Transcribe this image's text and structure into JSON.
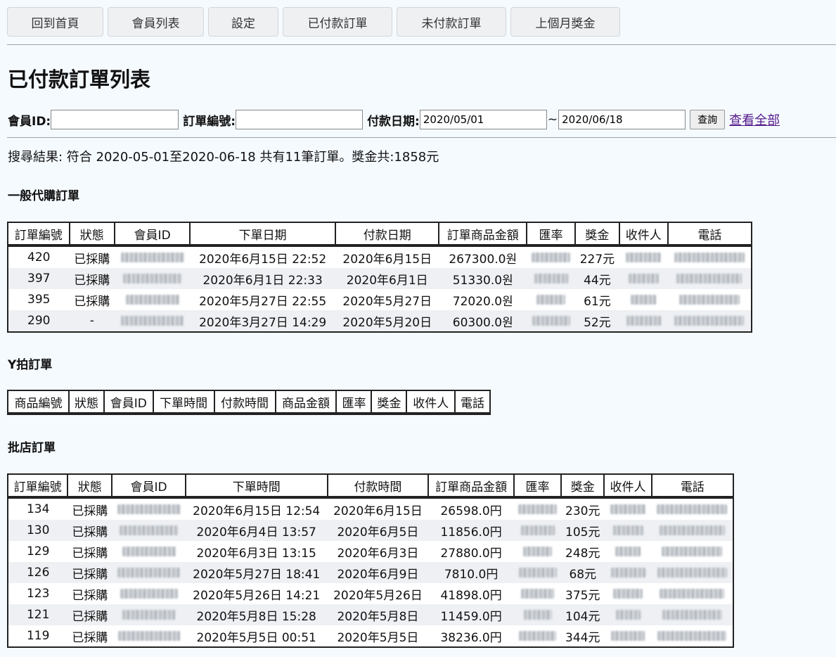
{
  "nav": {
    "items": [
      "回到首頁",
      "會員列表",
      "設定",
      "已付款訂單",
      "未付款訂單",
      "上個月獎金"
    ]
  },
  "page_title": "已付款訂單列表",
  "search": {
    "member_id_label": "會員ID:",
    "member_id_value": "",
    "order_no_label": "訂單編號:",
    "order_no_value": "",
    "pay_date_label": "付款日期:",
    "date_from": "2020/05/01",
    "tilde": "~",
    "date_to": "2020/06/18",
    "query_label": "查詢",
    "view_all_label": "查看全部"
  },
  "summary": "搜尋結果: 符合 2020-05-01至2020-06-18 共有11筆訂單。獎金共:1858元",
  "general": {
    "title": "一般代購訂單",
    "headers": [
      "訂單編號",
      "狀態",
      "會員ID",
      "下單日期",
      "付款日期",
      "訂單商品金額",
      "匯率",
      "獎金",
      "收件人",
      "電話"
    ],
    "rows": [
      {
        "id": "420",
        "status": "已採購",
        "order_date": "2020年6月15日 22:52",
        "pay_date": "2020年6月15日",
        "amount": "267300.0원",
        "bonus": "227元"
      },
      {
        "id": "397",
        "status": "已採購",
        "order_date": "2020年6月1日 22:33",
        "pay_date": "2020年6月1日",
        "amount": "51330.0원",
        "bonus": "44元"
      },
      {
        "id": "395",
        "status": "已採購",
        "order_date": "2020年5月27日 22:55",
        "pay_date": "2020年5月27日",
        "amount": "72020.0원",
        "bonus": "61元"
      },
      {
        "id": "290",
        "status": "-",
        "order_date": "2020年3月27日 14:29",
        "pay_date": "2020年5月20日",
        "amount": "60300.0원",
        "bonus": "52元"
      }
    ]
  },
  "y_auction": {
    "title": "Y拍訂單",
    "headers": [
      "商品編號",
      "狀態",
      "會員ID",
      "下單時間",
      "付款時間",
      "商品金額",
      "匯率",
      "獎金",
      "收件人",
      "電話"
    ]
  },
  "wholesale": {
    "title": "批店訂單",
    "headers": [
      "訂單編號",
      "狀態",
      "會員ID",
      "下單時間",
      "付款時間",
      "訂單商品金額",
      "匯率",
      "獎金",
      "收件人",
      "電話"
    ],
    "rows": [
      {
        "id": "134",
        "status": "已採購",
        "order_date": "2020年6月15日 12:54",
        "pay_date": "2020年6月15日",
        "amount": "26598.0円",
        "bonus": "230元"
      },
      {
        "id": "130",
        "status": "已採購",
        "order_date": "2020年6月4日 13:57",
        "pay_date": "2020年6月5日",
        "amount": "11856.0円",
        "bonus": "105元"
      },
      {
        "id": "129",
        "status": "已採購",
        "order_date": "2020年6月3日 13:15",
        "pay_date": "2020年6月3日",
        "amount": "27880.0円",
        "bonus": "248元"
      },
      {
        "id": "126",
        "status": "已採購",
        "order_date": "2020年5月27日 18:41",
        "pay_date": "2020年6月9日",
        "amount": "7810.0円",
        "bonus": "68元"
      },
      {
        "id": "123",
        "status": "已採購",
        "order_date": "2020年5月26日 14:21",
        "pay_date": "2020年5月26日",
        "amount": "41898.0円",
        "bonus": "375元"
      },
      {
        "id": "121",
        "status": "已採購",
        "order_date": "2020年5月8日 15:28",
        "pay_date": "2020年5月8日",
        "amount": "11459.0円",
        "bonus": "104元"
      },
      {
        "id": "119",
        "status": "已採購",
        "order_date": "2020年5月5日 00:51",
        "pay_date": "2020年5月5日",
        "amount": "38236.0円",
        "bonus": "344元"
      }
    ]
  }
}
